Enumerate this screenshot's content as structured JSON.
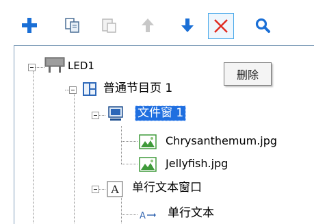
{
  "toolbar": {
    "buttons": [
      {
        "icon": "plus-icon",
        "enabled": true,
        "color": "#1a6fd6"
      },
      {
        "icon": "copy-icon",
        "enabled": true
      },
      {
        "icon": "paste-icon",
        "enabled": false
      },
      {
        "icon": "arrow-up-icon",
        "enabled": false
      },
      {
        "icon": "arrow-down-icon",
        "enabled": true,
        "color": "#1a6fd6"
      },
      {
        "icon": "close-icon",
        "enabled": true,
        "color": "#e0261c",
        "hovered": true
      },
      {
        "icon": "search-icon",
        "enabled": true,
        "color": "#1a6fd6"
      }
    ]
  },
  "tooltip": {
    "text": "删除"
  },
  "tree": {
    "nodes": [
      {
        "label": "LED1",
        "icon": "led-screen-icon",
        "level": 0,
        "expanded": true
      },
      {
        "label": "普通节目页 1",
        "icon": "program-page-icon",
        "level": 1,
        "expanded": true
      },
      {
        "label": "文件窗 1",
        "icon": "file-window-icon",
        "level": 2,
        "expanded": true,
        "selected": true
      },
      {
        "label": "Chrysanthemum.jpg",
        "icon": "image-icon",
        "level": 3
      },
      {
        "label": "Jellyfish.jpg",
        "icon": "image-icon",
        "level": 3
      },
      {
        "label": "单行文本窗口",
        "icon": "text-window-icon",
        "level": 2,
        "expanded": true
      },
      {
        "label": "单行文本",
        "icon": "single-line-text-icon",
        "level": 3
      }
    ]
  },
  "colors": {
    "accent_blue": "#1a6fd6",
    "delete_red": "#e0261c",
    "selection": "#1f6fe0",
    "image_green": "#3f9a3a"
  }
}
